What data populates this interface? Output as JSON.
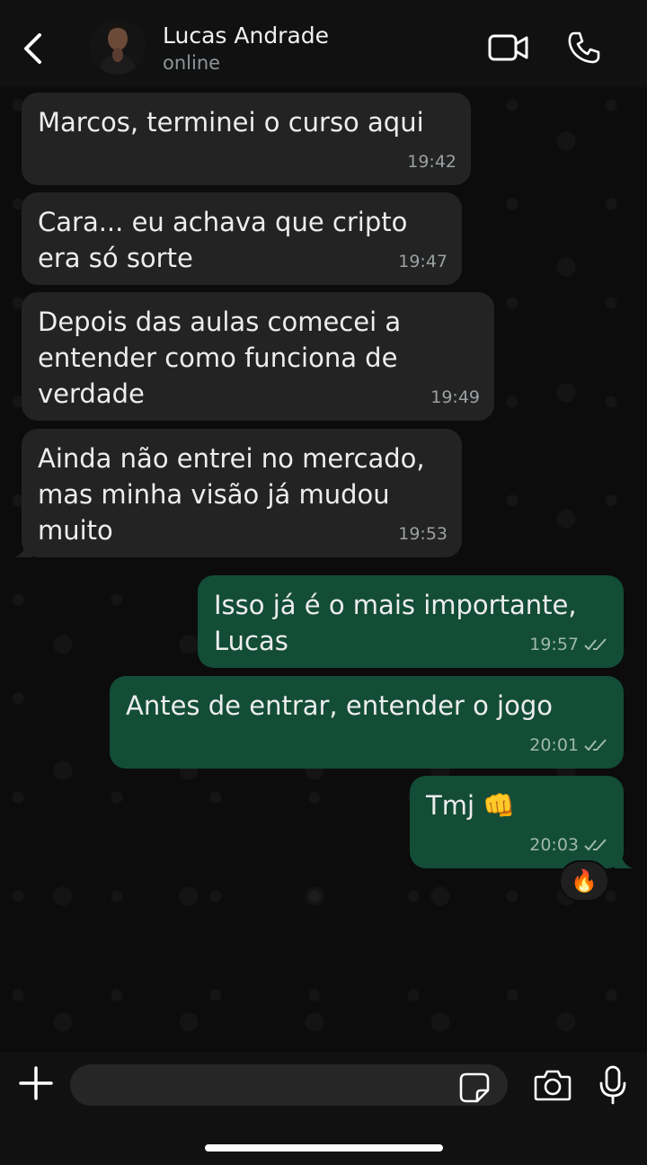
{
  "header": {
    "contact_name": "Lucas Andrade",
    "status": "online",
    "back_icon": "chevron-left-icon",
    "video_icon": "video-camera-icon",
    "call_icon": "phone-icon"
  },
  "messages": [
    {
      "direction": "incoming",
      "text": "Marcos, terminei o curso aqui",
      "time": "19:42"
    },
    {
      "direction": "incoming",
      "text": "Cara... eu achava que cripto\nera só sorte",
      "time": "19:47"
    },
    {
      "direction": "incoming",
      "text": "Depois das aulas comecei a\nentender como funciona de\nverdade",
      "time": "19:49"
    },
    {
      "direction": "incoming",
      "text": "Ainda não entrei no mercado,\nmas minha visão já mudou\nmuito",
      "time": "19:53"
    },
    {
      "direction": "outgoing",
      "text": "Isso já é o mais importante,\nLucas",
      "time": "19:57",
      "status": "read"
    },
    {
      "direction": "outgoing",
      "text": "Antes de entrar, entender o jogo",
      "time": "20:01",
      "status": "read"
    },
    {
      "direction": "outgoing",
      "text": "Tmj 👊",
      "time": "20:03",
      "status": "read",
      "reaction": "🔥"
    }
  ],
  "composer": {
    "placeholder": "",
    "plus_icon": "plus-icon",
    "sticker_icon": "sticker-icon",
    "camera_icon": "camera-icon",
    "mic_icon": "microphone-icon"
  },
  "colors": {
    "incoming_bubble": "#232323",
    "outgoing_bubble": "#134d37",
    "background": "#0c0c0c",
    "header": "#111111"
  }
}
